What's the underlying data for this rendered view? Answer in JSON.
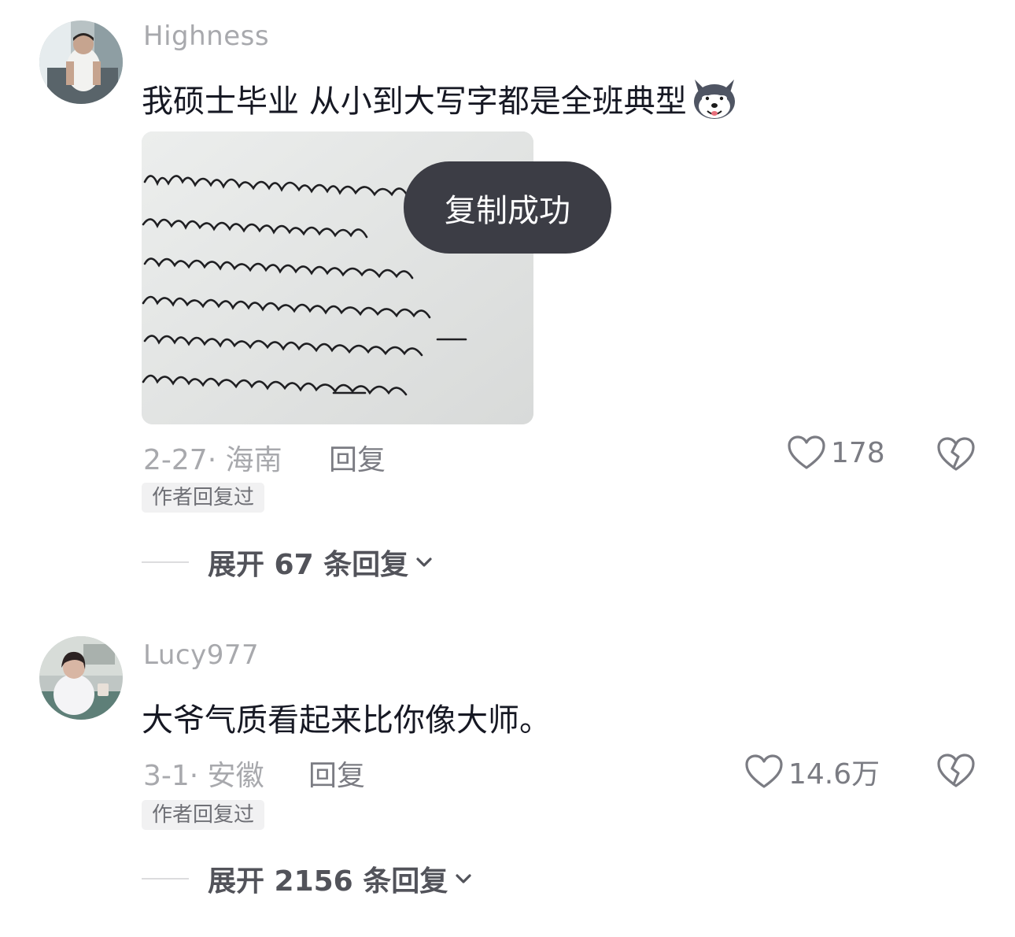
{
  "comments": [
    {
      "username": "Highness",
      "text": "我硕士毕业 从小到大写字都是全班典型",
      "emoji_icon": "husky-face-icon",
      "has_image": true,
      "meta": "2-27· 海南",
      "reply_label": "回复",
      "like_count": "178",
      "badge": "作者回复过",
      "expand_label": "展开 67 条回复"
    },
    {
      "username": "Lucy977",
      "text": "大爷气质看起来比你像大师。",
      "meta": "3-1· 安徽",
      "reply_label": "回复",
      "like_count": "14.6万",
      "badge": "作者回复过",
      "expand_label": "展开 2156 条回复"
    }
  ],
  "toast": {
    "text": "复制成功"
  },
  "icons": {
    "like": "heart-outline-icon",
    "dislike": "broken-heart-icon",
    "expand": "chevron-down-icon"
  },
  "colors": {
    "background": "#ffffff",
    "username": "#a8a9ad",
    "text": "#161823",
    "toast_bg": "#3c3d45",
    "badge_bg": "#f1f1f2"
  }
}
